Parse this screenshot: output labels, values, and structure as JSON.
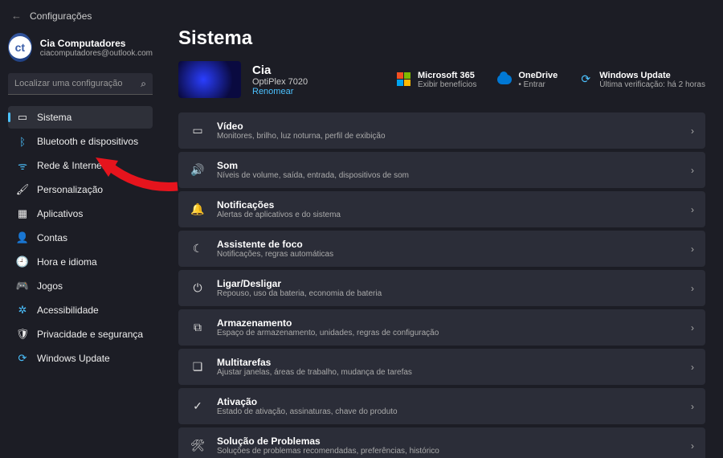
{
  "header": {
    "back": "←",
    "title": "Configurações"
  },
  "profile": {
    "initials": "ct",
    "name": "Cia Computadores",
    "email": "ciacomputadores@outlook.com"
  },
  "search": {
    "placeholder": "Localizar uma configuração"
  },
  "nav": [
    {
      "icon": "▭",
      "label": "Sistema",
      "active": true,
      "cls": ""
    },
    {
      "icon": "ᛒ",
      "label": "Bluetooth e dispositivos",
      "active": false,
      "cls": "c-blue"
    },
    {
      "icon": "ᯤ",
      "label": "Rede & Internet",
      "active": false,
      "cls": "c-blue"
    },
    {
      "icon": "🖌",
      "label": "Personalização",
      "active": false,
      "cls": ""
    },
    {
      "icon": "▦",
      "label": "Aplicativos",
      "active": false,
      "cls": ""
    },
    {
      "icon": "👤",
      "label": "Contas",
      "active": false,
      "cls": "c-teal"
    },
    {
      "icon": "🕘",
      "label": "Hora e idioma",
      "active": false,
      "cls": "c-orange"
    },
    {
      "icon": "🎮",
      "label": "Jogos",
      "active": false,
      "cls": ""
    },
    {
      "icon": "✲",
      "label": "Acessibilidade",
      "active": false,
      "cls": "c-blue"
    },
    {
      "icon": "🛡",
      "label": "Privacidade e segurança",
      "active": false,
      "cls": ""
    },
    {
      "icon": "⟳",
      "label": "Windows Update",
      "active": false,
      "cls": "c-blue"
    }
  ],
  "page": {
    "title": "Sistema"
  },
  "device": {
    "name": "Cia",
    "model": "OptiPlex 7020",
    "rename": "Renomear"
  },
  "services": [
    {
      "icon": "ms",
      "title": "Microsoft 365",
      "sub": "Exibir benefícios"
    },
    {
      "icon": "cloud",
      "title": "OneDrive",
      "sub": "• Entrar"
    },
    {
      "icon": "⟳",
      "title": "Windows Update",
      "sub": "Última verificação: há 2 horas"
    }
  ],
  "cards": [
    {
      "icon": "▭",
      "title": "Vídeo",
      "sub": "Monitores, brilho, luz noturna, perfil de exibição"
    },
    {
      "icon": "🔊",
      "title": "Som",
      "sub": "Níveis de volume, saída, entrada, dispositivos de som"
    },
    {
      "icon": "🔔",
      "title": "Notificações",
      "sub": "Alertas de aplicativos e do sistema"
    },
    {
      "icon": "☾",
      "title": "Assistente de foco",
      "sub": "Notificações, regras automáticas"
    },
    {
      "icon": "⏻",
      "title": "Ligar/Desligar",
      "sub": "Repouso, uso da bateria, economia de bateria"
    },
    {
      "icon": "⧉",
      "title": "Armazenamento",
      "sub": "Espaço de armazenamento, unidades, regras de configuração"
    },
    {
      "icon": "❏",
      "title": "Multitarefas",
      "sub": "Ajustar janelas, áreas de trabalho, mudança de tarefas"
    },
    {
      "icon": "✓",
      "title": "Ativação",
      "sub": "Estado de ativação, assinaturas, chave do produto"
    },
    {
      "icon": "🛠",
      "title": "Solução de Problemas",
      "sub": "Soluções de problemas recomendadas, preferências, histórico"
    }
  ]
}
